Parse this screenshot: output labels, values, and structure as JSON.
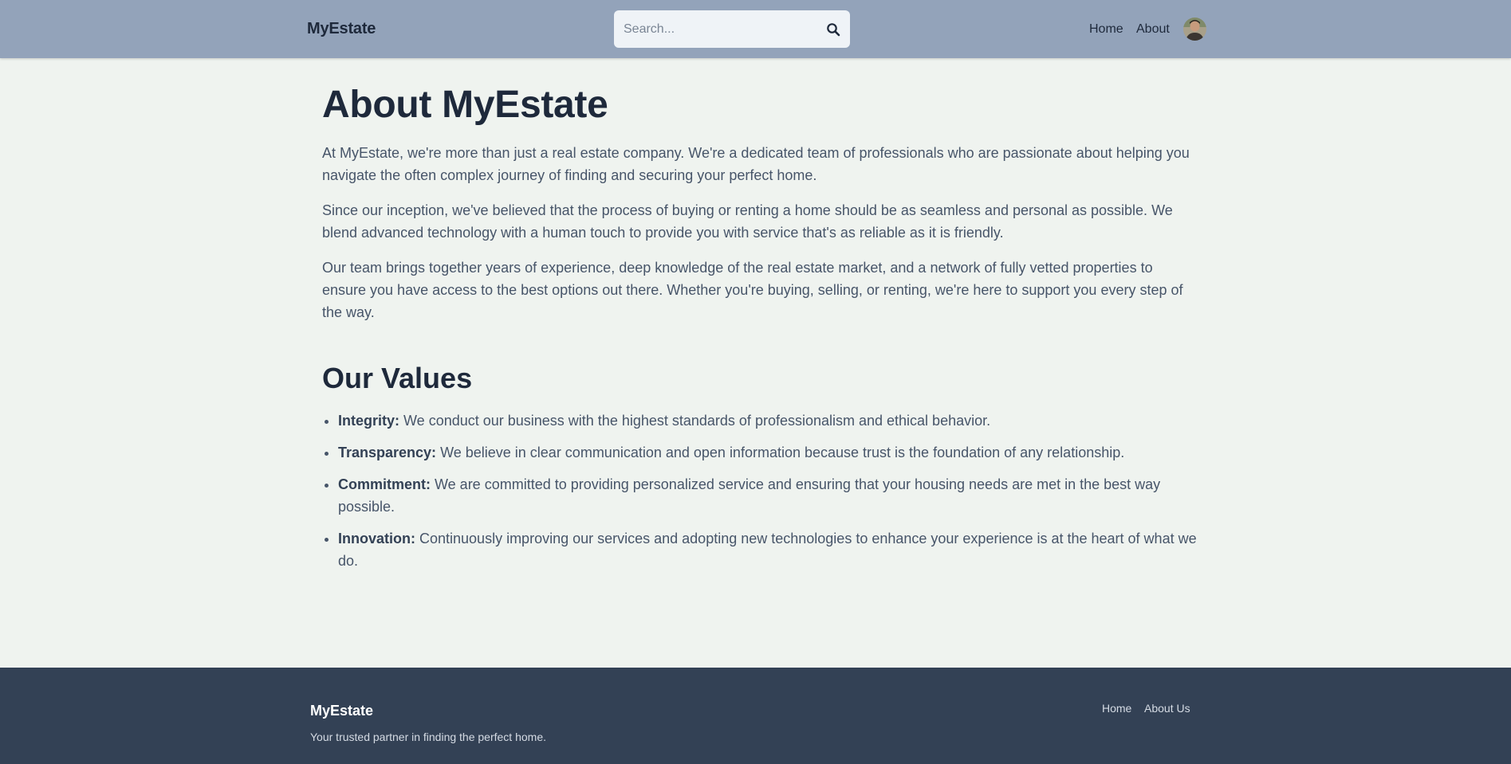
{
  "header": {
    "brand": "MyEstate",
    "search_placeholder": "Search...",
    "nav": [
      "Home",
      "About"
    ]
  },
  "main": {
    "title": "About MyEstate",
    "paragraphs": [
      "At MyEstate, we're more than just a real estate company. We're a dedicated team of professionals who are passionate about helping you navigate the often complex journey of finding and securing your perfect home.",
      "Since our inception, we've believed that the process of buying or renting a home should be as seamless and personal as possible. We blend advanced technology with a human touch to provide you with service that's as reliable as it is friendly.",
      "Our team brings together years of experience, deep knowledge of the real estate market, and a network of fully vetted properties to ensure you have access to the best options out there. Whether you're buying, selling, or renting, we're here to support you every step of the way."
    ],
    "values_title": "Our Values",
    "values": [
      {
        "name": "Integrity:",
        "text": " We conduct our business with the highest standards of professionalism and ethical behavior."
      },
      {
        "name": "Transparency:",
        "text": " We believe in clear communication and open information because trust is the foundation of any relationship."
      },
      {
        "name": "Commitment:",
        "text": " We are committed to providing personalized service and ensuring that your housing needs are met in the best way possible."
      },
      {
        "name": "Innovation:",
        "text": " Continuously improving our services and adopting new technologies to enhance your experience is at the heart of what we do."
      }
    ]
  },
  "footer": {
    "brand": "MyEstate",
    "tagline": "Your trusted partner in finding the perfect home.",
    "links": [
      "Home",
      "About Us"
    ]
  },
  "icons": {
    "search": "search-icon",
    "avatar": "user-avatar"
  },
  "colors": {
    "header_bg": "#93a3ba",
    "page_bg": "#eff3ef",
    "footer_bg": "#334155",
    "heading": "#1e293b",
    "body_text": "#475569"
  }
}
